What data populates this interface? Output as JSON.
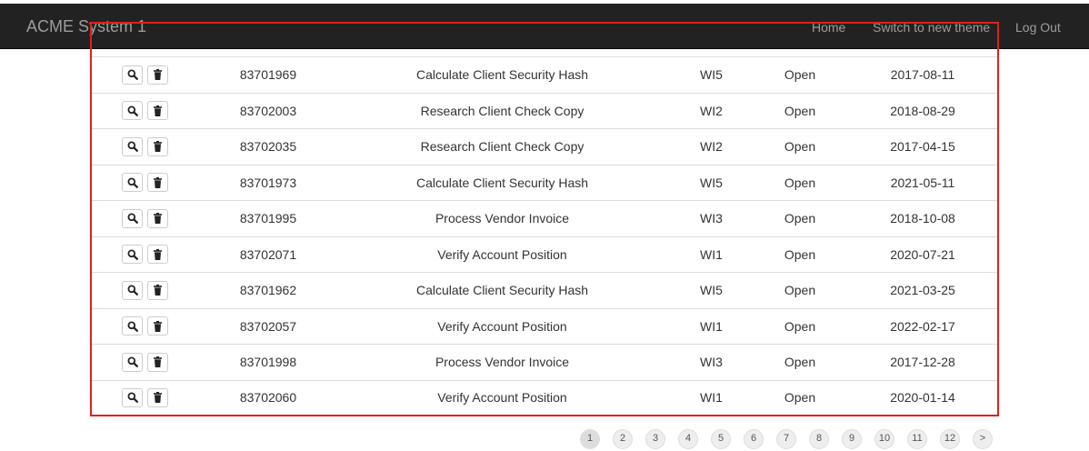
{
  "navbar": {
    "brand": "ACME System 1",
    "links": [
      "Home",
      "Switch to new theme",
      "Log Out"
    ]
  },
  "table": {
    "rows": [
      {
        "id": "83701969",
        "description": "Calculate Client Security Hash",
        "wi": "WI5",
        "status": "Open",
        "date": "2017-08-11"
      },
      {
        "id": "83702003",
        "description": "Research Client Check Copy",
        "wi": "WI2",
        "status": "Open",
        "date": "2018-08-29"
      },
      {
        "id": "83702035",
        "description": "Research Client Check Copy",
        "wi": "WI2",
        "status": "Open",
        "date": "2017-04-15"
      },
      {
        "id": "83701973",
        "description": "Calculate Client Security Hash",
        "wi": "WI5",
        "status": "Open",
        "date": "2021-05-11"
      },
      {
        "id": "83701995",
        "description": "Process Vendor Invoice",
        "wi": "WI3",
        "status": "Open",
        "date": "2018-10-08"
      },
      {
        "id": "83702071",
        "description": "Verify Account Position",
        "wi": "WI1",
        "status": "Open",
        "date": "2020-07-21"
      },
      {
        "id": "83701962",
        "description": "Calculate Client Security Hash",
        "wi": "WI5",
        "status": "Open",
        "date": "2021-03-25"
      },
      {
        "id": "83702057",
        "description": "Verify Account Position",
        "wi": "WI1",
        "status": "Open",
        "date": "2022-02-17"
      },
      {
        "id": "83701998",
        "description": "Process Vendor Invoice",
        "wi": "WI3",
        "status": "Open",
        "date": "2017-12-28"
      },
      {
        "id": "83702060",
        "description": "Verify Account Position",
        "wi": "WI1",
        "status": "Open",
        "date": "2020-01-14"
      }
    ],
    "row_icons": [
      "search-icon",
      "trash-icon"
    ]
  },
  "pagination": {
    "pages": [
      "1",
      "2",
      "3",
      "4",
      "5",
      "6",
      "7",
      "8",
      "9",
      "10",
      "11",
      "12",
      ">"
    ],
    "active": "1"
  },
  "colors": {
    "navbar_bg": "#222222",
    "navbar_text": "#9d9d9d",
    "highlight_frame": "#e02020",
    "row_border": "#dddddd"
  }
}
